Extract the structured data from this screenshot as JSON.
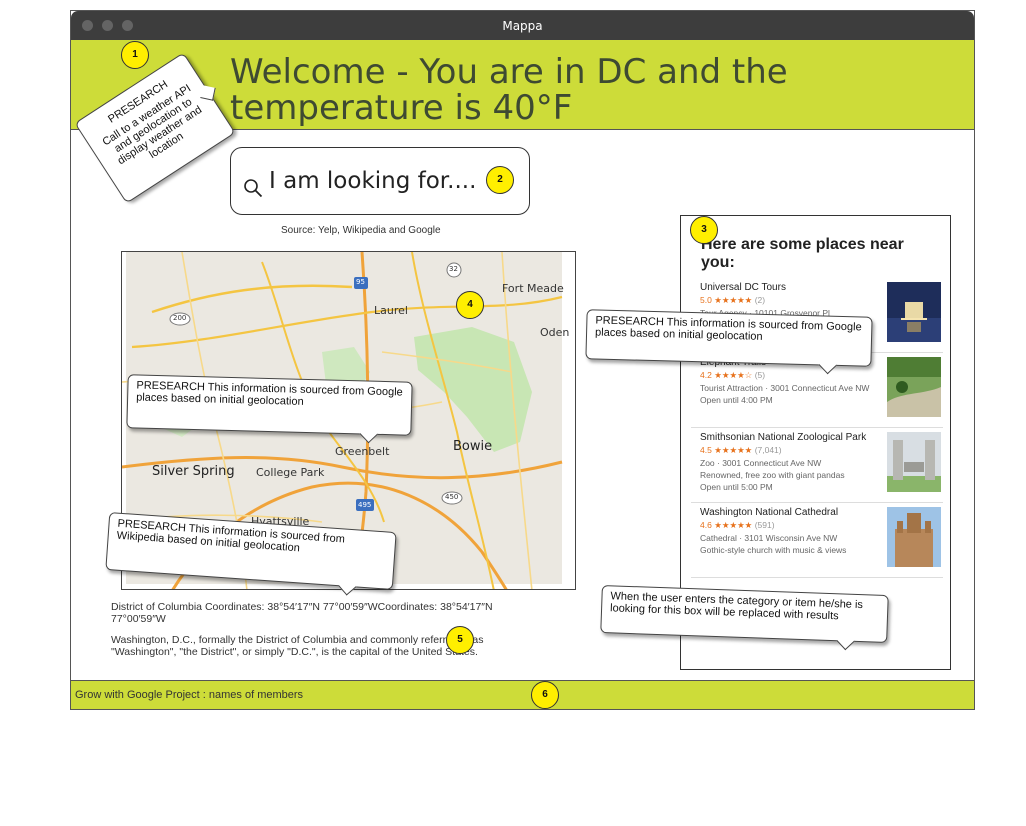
{
  "window": {
    "title": "Mappa"
  },
  "header": {
    "welcome": "Welcome - You are in DC and the temperature is 40°F"
  },
  "search": {
    "placeholder": "I am looking for....",
    "source_note": "Source: Yelp, Wikipedia and Google"
  },
  "map": {
    "labels": {
      "laurel": "Laurel",
      "fort_meade": "Fort Meade",
      "odenton": "Oden",
      "bowie": "Bowie",
      "silver_spring": "Silver Spring",
      "college_park": "College Park",
      "greenbelt": "Greenbelt",
      "hyattsville": "Hyattsville"
    },
    "route_shields": {
      "i95": "95",
      "r32": "32",
      "r200": "200",
      "r450": "450",
      "i495": "495"
    }
  },
  "location_info": {
    "coordinates": "District of Columbia Coordinates: 38°54′17″N 77°00′59″WCoordinates: 38°54′17″N 77°00′59″W",
    "description": "Washington, D.C., formally the District of Columbia and commonly referred to as \"Washington\", \"the District\", or simply \"D.C.\", is the capital of the United States."
  },
  "places": {
    "heading": "Here are some places near you:",
    "items": [
      {
        "name": "Universal DC Tours",
        "rating": "5.0",
        "stars": "★★★★★",
        "count": "(2)",
        "type": "Tour Agency · 10101 Grosvenor Pl",
        "extra": ""
      },
      {
        "name": "Elephant Trails",
        "rating": "4.2",
        "stars": "★★★★☆",
        "count": "(5)",
        "type": "Tourist Attraction · 3001 Connecticut Ave NW",
        "extra": "Open until 4:00 PM"
      },
      {
        "name": "Smithsonian National Zoological Park",
        "rating": "4.5",
        "stars": "★★★★★",
        "count": "(7,041)",
        "type": "Zoo · 3001 Connecticut Ave NW",
        "extra": "Renowned, free zoo with giant pandas",
        "extra2": "Open until 5:00 PM"
      },
      {
        "name": "Washington National Cathedral",
        "rating": "4.6",
        "stars": "★★★★★",
        "count": "(591)",
        "type": "Cathedral · 3101 Wisconsin Ave NW",
        "extra": "Gothic-style church with music & views"
      }
    ]
  },
  "footer": {
    "text": "Grow with Google Project : names of members"
  },
  "markers": [
    "1",
    "2",
    "3",
    "4",
    "5",
    "6"
  ],
  "callouts": {
    "weather": {
      "title": "PRESEARCH",
      "body": "Call to a weather API and geolocation to display weather and location"
    },
    "places_google": "PRESEARCH This information is sourced from Google places  based on initial geolocation",
    "map_google": "PRESEARCH This information is sourced from Google places  based on initial geolocation",
    "wikipedia": "PRESEARCH This information is sourced from Wikipedia  based on initial geolocation",
    "results_note": "When the user enters the category or item he/she is looking for this box will be replaced with results"
  },
  "colors": {
    "accent": "#cddc39",
    "marker": "#ffef00",
    "titlebar": "#3d3d3d",
    "star": "#e7711b"
  }
}
